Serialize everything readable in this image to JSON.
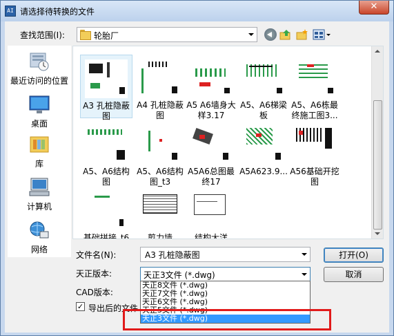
{
  "window": {
    "title": "请选择待转换的文件",
    "close_glyph": "✕",
    "app_icon_text": "AI"
  },
  "lookin": {
    "label": "查找范围(I):",
    "value": "轮胎厂"
  },
  "toolbar": {
    "back": "back-icon",
    "up": "up-folder-icon",
    "new_folder": "new-folder-icon",
    "view": "view-menu-icon"
  },
  "places": [
    {
      "label": "最近访问的位置",
      "icon": "recent-places-icon"
    },
    {
      "label": "桌面",
      "icon": "desktop-icon"
    },
    {
      "label": "库",
      "icon": "libraries-icon"
    },
    {
      "label": "计算机",
      "icon": "computer-icon"
    },
    {
      "label": "网络",
      "icon": "network-icon"
    }
  ],
  "files": [
    {
      "name": "A3 孔桩隐蔽图",
      "selected": true
    },
    {
      "name": "A4 孔桩隐蔽图"
    },
    {
      "name": "A5 A6墙身大样3.17"
    },
    {
      "name": "A5、A6梯梁板"
    },
    {
      "name": "A5、A6栋最终施工图3..."
    },
    {
      "name": "A5、A6结构图"
    },
    {
      "name": "A5、A6结构图_t3"
    },
    {
      "name": "A5A6总图最终17"
    },
    {
      "name": "A5A623.9..."
    },
    {
      "name": "A56基础开挖图"
    },
    {
      "name": "基础拼接_t6"
    },
    {
      "name": "剪力墙"
    },
    {
      "name": "结构大洋"
    }
  ],
  "filename": {
    "label": "文件名(N):",
    "value": "A3 孔桩隐蔽图"
  },
  "version": {
    "label": "天正版本:",
    "value": "天正3文件 (*.dwg)"
  },
  "cad": {
    "label": "CAD版本:"
  },
  "export": {
    "label": "导出后的文件",
    "checked": "✓"
  },
  "buttons": {
    "open": "打开(O)",
    "cancel": "取消"
  },
  "version_options": [
    {
      "label": "天正8文件 (*.dwg)"
    },
    {
      "label": "天正7文件 (*.dwg)"
    },
    {
      "label": "天正6文件 (*.dwg)"
    },
    {
      "label": "天正5文件 (*.dwg)"
    },
    {
      "label": "天正3文件 (*.dwg)",
      "selected": true
    }
  ],
  "colors": {
    "accent": "#3399ff",
    "highlight_box": "#e11a1a"
  }
}
